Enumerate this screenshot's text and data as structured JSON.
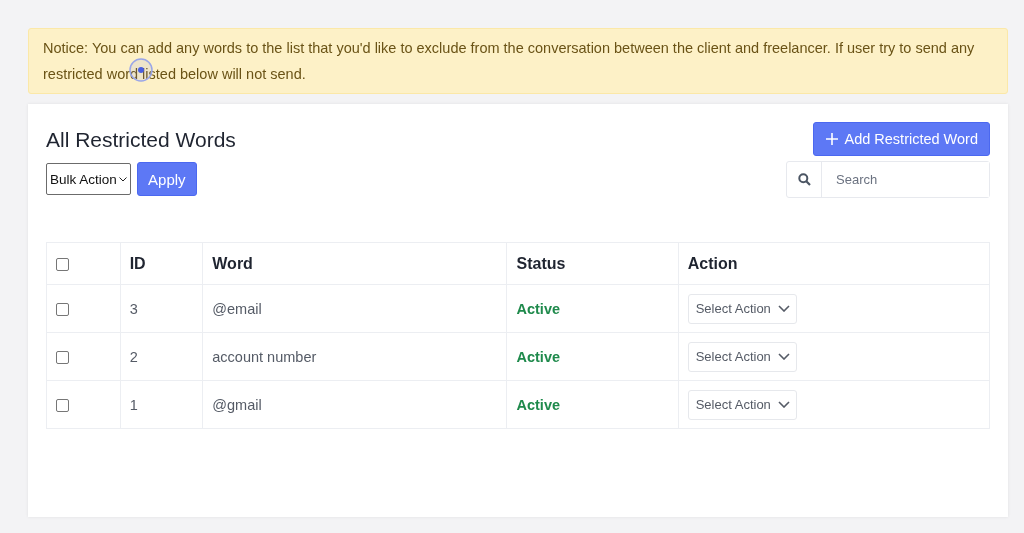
{
  "notice": {
    "text": "Notice: You can add any words to the list that you'd like to exclude from the conversation between the client and freelancer. If user try to send any restricted word listed below will not send."
  },
  "card": {
    "title": "All Restricted Words",
    "add_button": "Add Restricted Word",
    "bulk_action": {
      "value": "Bulk Action"
    },
    "apply_button": "Apply",
    "search": {
      "placeholder": "Search"
    }
  },
  "table": {
    "select_all": {
      "checked": false
    },
    "columns": [
      "ID",
      "Word",
      "Status",
      "Action"
    ],
    "rows": [
      {
        "checked": false,
        "id": "3",
        "word": "@email",
        "status": "Active",
        "active": true,
        "action": "Select Action"
      },
      {
        "checked": false,
        "id": "2",
        "word": "account number",
        "status": "Active",
        "active": true,
        "action": "Select Action"
      },
      {
        "checked": false,
        "id": "1",
        "word": "@gmail",
        "status": "Active",
        "active": true,
        "action": "Select Action"
      }
    ]
  }
}
